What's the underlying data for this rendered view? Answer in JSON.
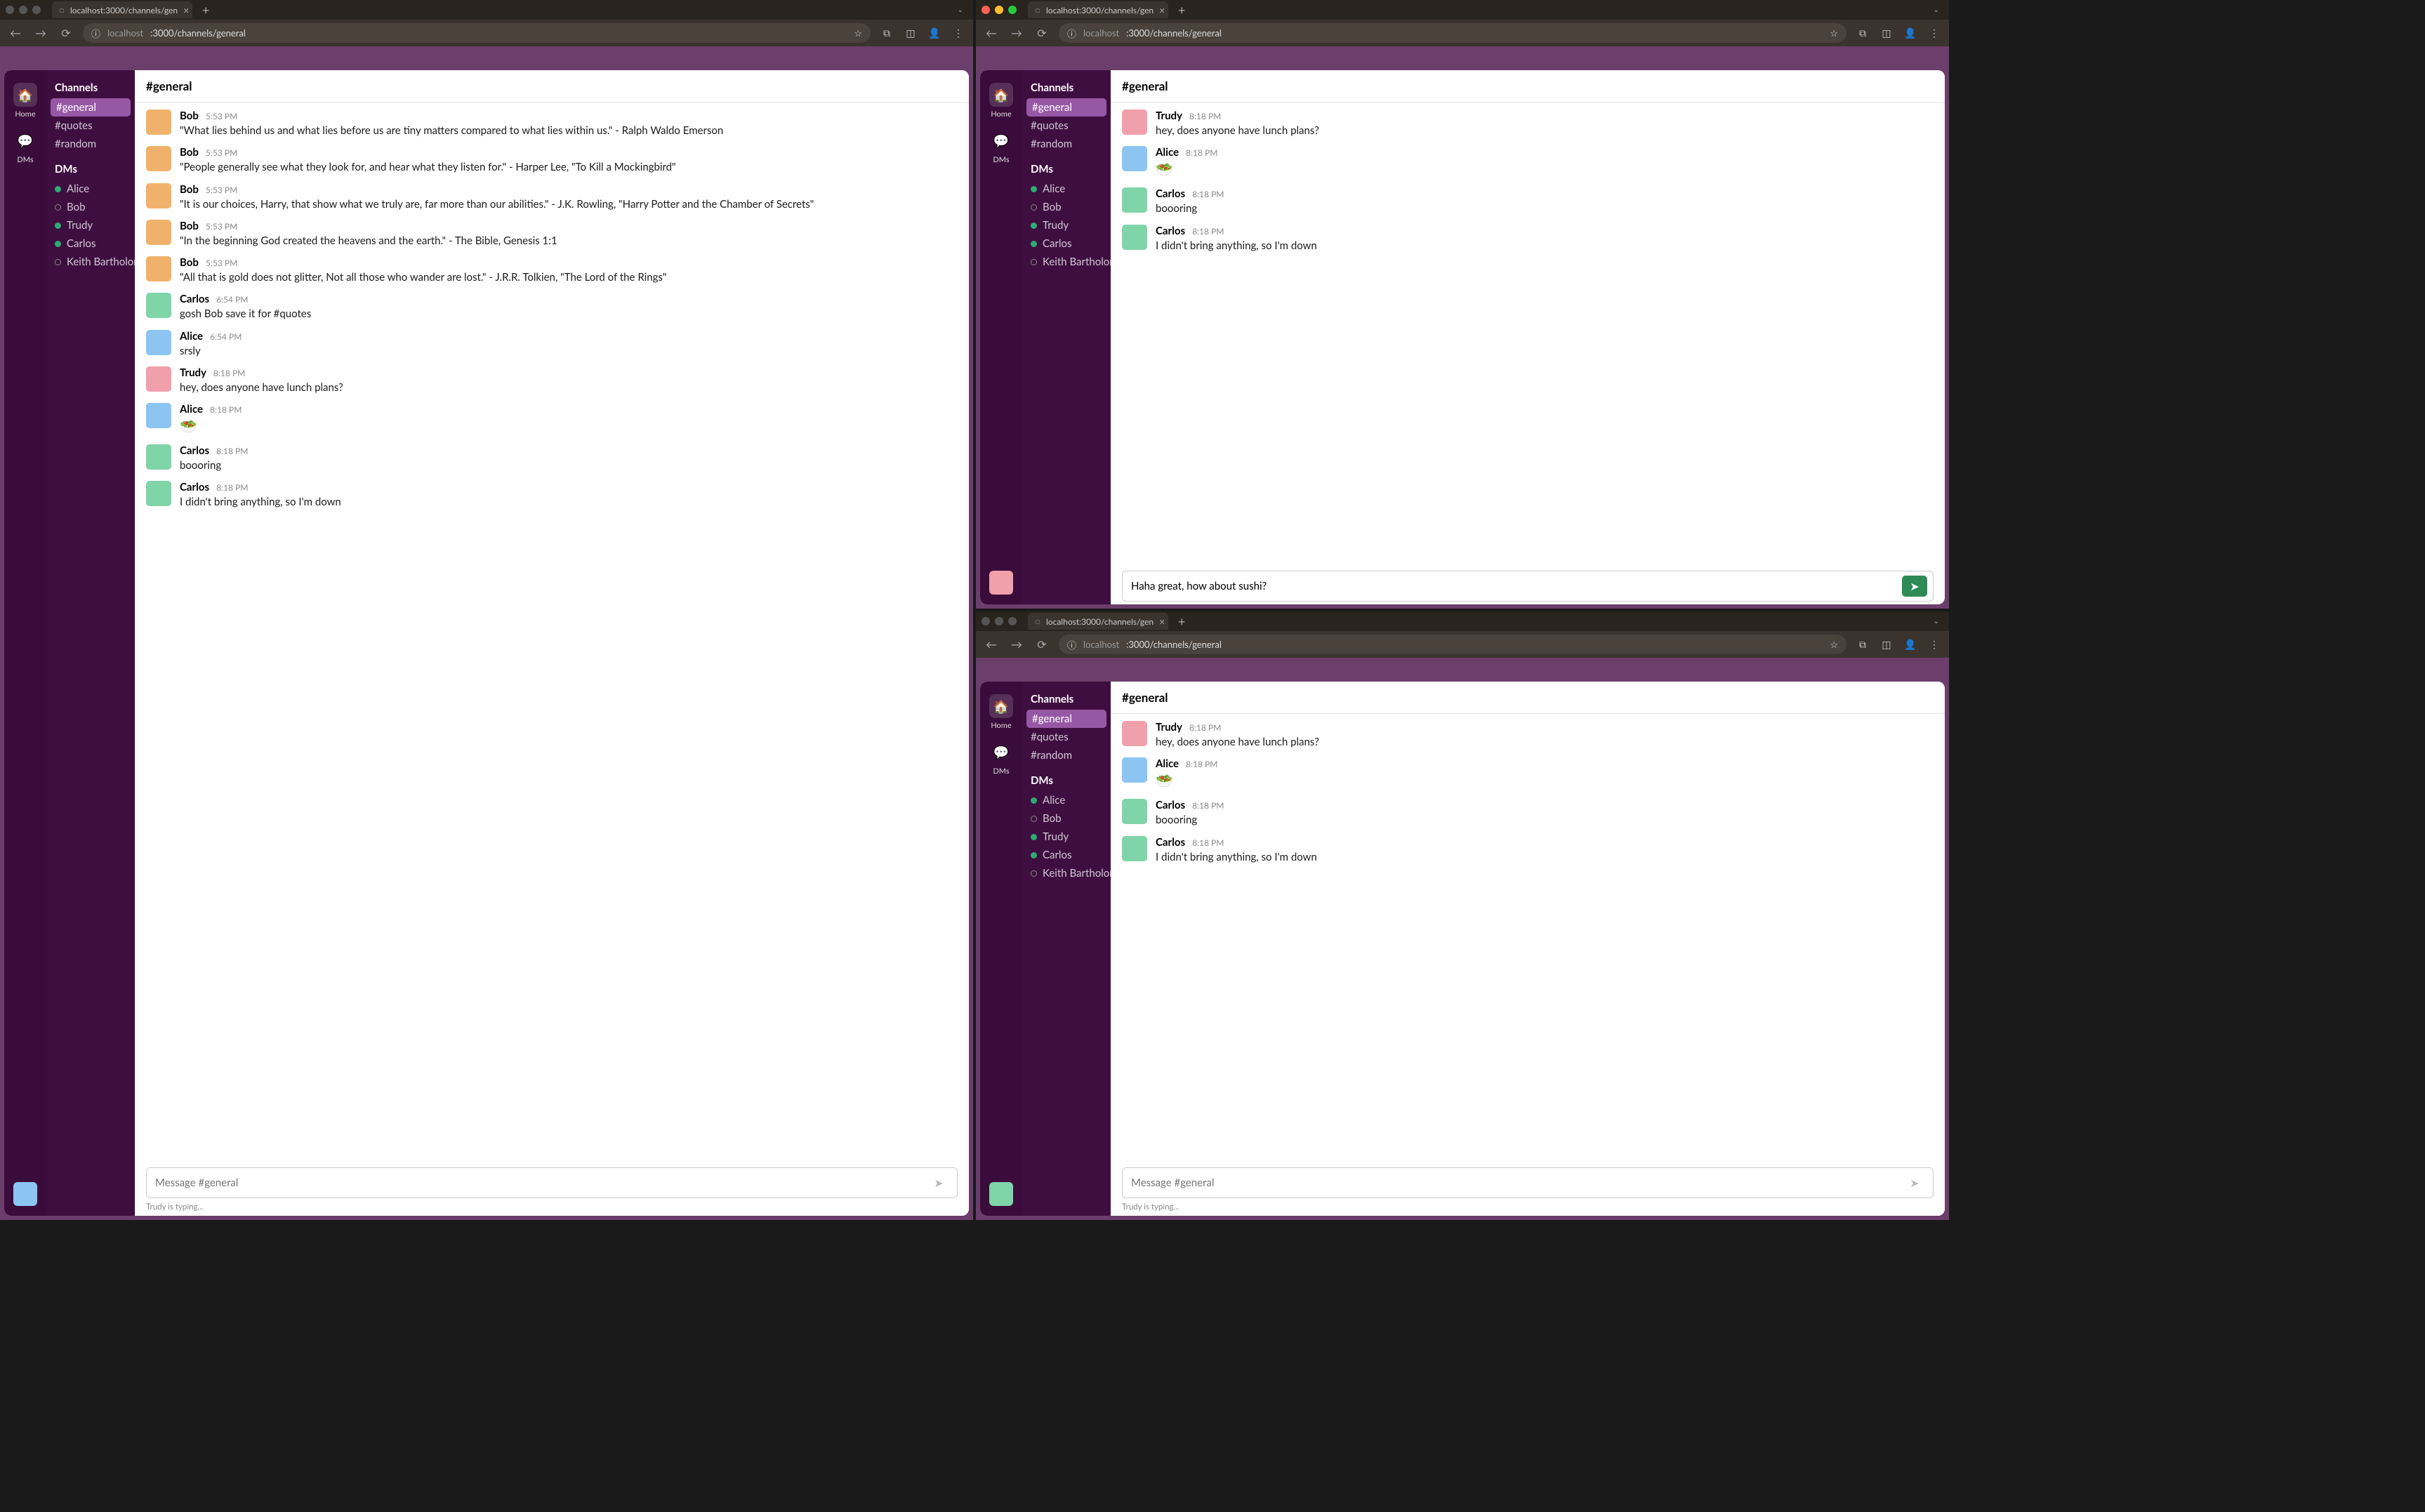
{
  "shared": {
    "tab_title": "localhost:3000/channels/gen",
    "url_display_host": "localhost",
    "url_display_path": ":3000/channels/general",
    "rail": {
      "home": "Home",
      "dms": "DMs",
      "home_icon": "🏠",
      "dms_icon": "💬"
    },
    "sidebar": {
      "channels_label": "Channels",
      "dms_label": "DMs",
      "channels": [
        "#general",
        "#quotes",
        "#random"
      ],
      "dms": [
        {
          "name": "Alice",
          "online": true
        },
        {
          "name": "Bob",
          "online": false
        },
        {
          "name": "Trudy",
          "online": true
        },
        {
          "name": "Carlos",
          "online": true
        },
        {
          "name": "Keith Bartholomew",
          "online": false
        }
      ]
    },
    "channel_header": "#general",
    "compose_placeholder": "Message #general",
    "typing": "Trudy is typing..."
  },
  "windows": [
    {
      "traffic_dim": true,
      "self_avatar": "c-blue",
      "compose_value": "",
      "messages": [
        {
          "author": "Bob",
          "time": "5:53 PM",
          "avatar": "c-orange",
          "body": "\"What lies behind us and what lies before us are tiny matters compared to what lies within us.\" - Ralph Waldo Emerson"
        },
        {
          "author": "Bob",
          "time": "5:53 PM",
          "avatar": "c-orange",
          "body": "\"People generally see what they look for, and hear what they listen for.\" - Harper Lee, \"To Kill a Mockingbird\""
        },
        {
          "author": "Bob",
          "time": "5:53 PM",
          "avatar": "c-orange",
          "body": "\"It is our choices, Harry, that show what we truly are, far more than our abilities.\" - J.K. Rowling, \"Harry Potter and the Chamber of Secrets\""
        },
        {
          "author": "Bob",
          "time": "5:53 PM",
          "avatar": "c-orange",
          "body": "\"In the beginning God created the heavens and the earth.\" - The Bible, Genesis 1:1"
        },
        {
          "author": "Bob",
          "time": "5:53 PM",
          "avatar": "c-orange",
          "body": "\"All that is gold does not glitter, Not all those who wander are lost.\" - J.R.R. Tolkien, \"The Lord of the Rings\""
        },
        {
          "author": "Carlos",
          "time": "6:54 PM",
          "avatar": "c-green",
          "body": "gosh Bob save it for #quotes"
        },
        {
          "author": "Alice",
          "time": "6:54 PM",
          "avatar": "c-blue",
          "body": "srsly"
        },
        {
          "author": "Trudy",
          "time": "8:18 PM",
          "avatar": "c-pink",
          "body": "hey, does anyone have lunch plans?"
        },
        {
          "author": "Alice",
          "time": "8:18 PM",
          "avatar": "c-blue",
          "body": "🥗",
          "emoji": true
        },
        {
          "author": "Carlos",
          "time": "8:18 PM",
          "avatar": "c-green",
          "body": "boooring"
        },
        {
          "author": "Carlos",
          "time": "8:18 PM",
          "avatar": "c-green",
          "body": "I didn't bring anything, so I'm down"
        }
      ]
    },
    {
      "traffic_dim": false,
      "self_avatar": "c-pink",
      "compose_value": "Haha great, how about sushi?",
      "messages": [
        {
          "author": "Trudy",
          "time": "8:18 PM",
          "avatar": "c-pink",
          "body": "hey, does anyone have lunch plans?"
        },
        {
          "author": "Alice",
          "time": "8:18 PM",
          "avatar": "c-blue",
          "body": "🥗",
          "emoji": true
        },
        {
          "author": "Carlos",
          "time": "8:18 PM",
          "avatar": "c-green",
          "body": "boooring"
        },
        {
          "author": "Carlos",
          "time": "8:18 PM",
          "avatar": "c-green",
          "body": "I didn't bring anything, so I'm down"
        }
      ]
    },
    {
      "traffic_dim": true,
      "self_avatar": "c-green",
      "compose_value": "",
      "messages": [
        {
          "author": "Trudy",
          "time": "8:18 PM",
          "avatar": "c-pink",
          "body": "hey, does anyone have lunch plans?"
        },
        {
          "author": "Alice",
          "time": "8:18 PM",
          "avatar": "c-blue",
          "body": "🥗",
          "emoji": true
        },
        {
          "author": "Carlos",
          "time": "8:18 PM",
          "avatar": "c-green",
          "body": "boooring"
        },
        {
          "author": "Carlos",
          "time": "8:18 PM",
          "avatar": "c-green",
          "body": "I didn't bring anything, so I'm down"
        }
      ]
    }
  ]
}
